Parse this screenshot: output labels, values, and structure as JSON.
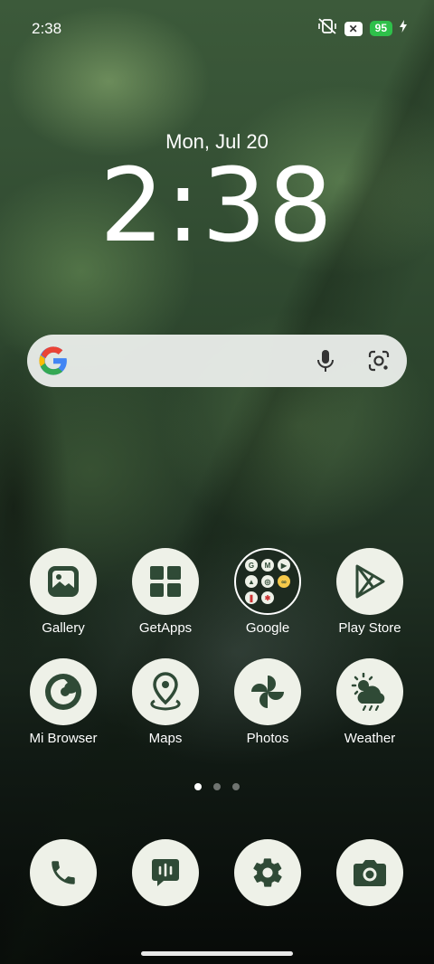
{
  "status_bar": {
    "time": "2:38",
    "battery": "95"
  },
  "lockclock": {
    "date": "Mon, Jul 20",
    "time": "2:38"
  },
  "apps_row1": [
    {
      "label": "Gallery",
      "icon": "gallery-icon"
    },
    {
      "label": "GetApps",
      "icon": "getapps-icon"
    },
    {
      "label": "Google",
      "icon": "google-folder-icon"
    },
    {
      "label": "Play Store",
      "icon": "play-store-icon"
    }
  ],
  "apps_row2": [
    {
      "label": "Mi Browser",
      "icon": "mi-browser-icon"
    },
    {
      "label": "Maps",
      "icon": "maps-icon"
    },
    {
      "label": "Photos",
      "icon": "photos-icon"
    },
    {
      "label": "Weather",
      "icon": "weather-icon"
    }
  ],
  "dock": [
    {
      "icon": "phone-icon"
    },
    {
      "icon": "messages-icon"
    },
    {
      "icon": "settings-icon"
    },
    {
      "icon": "camera-icon"
    }
  ],
  "page_indicator": {
    "count": 3,
    "active": 1
  },
  "colors": {
    "icon_bg": "#eef1e8",
    "icon_fg": "#2f4a36",
    "battery": "#2ec04a"
  }
}
